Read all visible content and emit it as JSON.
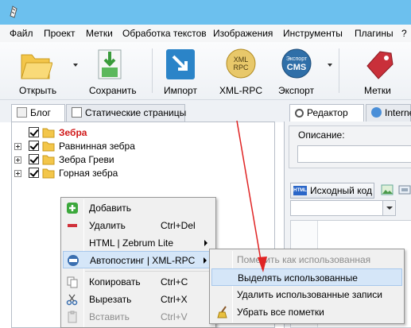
{
  "colors": {
    "titlebar": "#6cc0ee",
    "highlight": "#d5e6f8",
    "arrow": "#e02424",
    "red_label": "#d01818"
  },
  "menubar": {
    "items": [
      "Файл",
      "Проект",
      "Метки",
      "Обработка текстов",
      "Изображения",
      "Инструменты",
      "Плагины",
      "?"
    ]
  },
  "toolbar": {
    "open": "Открыть",
    "save": "Сохранить",
    "import": "Импорт",
    "xmlrpc": "XML-RPC",
    "xmlrpc_icon_text": "XML RPC",
    "export": "Экспорт",
    "export_icon_text": "Экспорт CMS",
    "tags": "Метки"
  },
  "left_tabs": {
    "blog": "Блог",
    "static_pages": "Статические страницы"
  },
  "right_tabs": {
    "editor": "Редактор",
    "internet": "Interne"
  },
  "tree": [
    {
      "label": "Зебра",
      "highlighted": true
    },
    {
      "label": "Равнинная зебра",
      "highlighted": false
    },
    {
      "label": "Зебра Греви",
      "highlighted": false
    },
    {
      "label": "Горная зебра",
      "highlighted": false
    }
  ],
  "editor": {
    "description_label": "Описание:",
    "source_button": "Исходный код",
    "html_icon_text": "HTML"
  },
  "context_menu": {
    "add": "Добавить",
    "delete": "Удалить",
    "delete_shortcut": "Ctrl+Del",
    "html_zebrum": "HTML | Zebrum Lite",
    "autoposting": "Автопостинг | XML-RPC",
    "copy": "Копировать",
    "copy_shortcut": "Ctrl+C",
    "cut": "Вырезать",
    "cut_shortcut": "Ctrl+X",
    "paste": "Вставить",
    "paste_shortcut": "Ctrl+V"
  },
  "submenu": {
    "mark_used": "Пометить как использованная",
    "highlight_used": "Выделять использованные",
    "delete_used": "Удалить использованные записи",
    "remove_marks": "Убрать все пометки"
  }
}
